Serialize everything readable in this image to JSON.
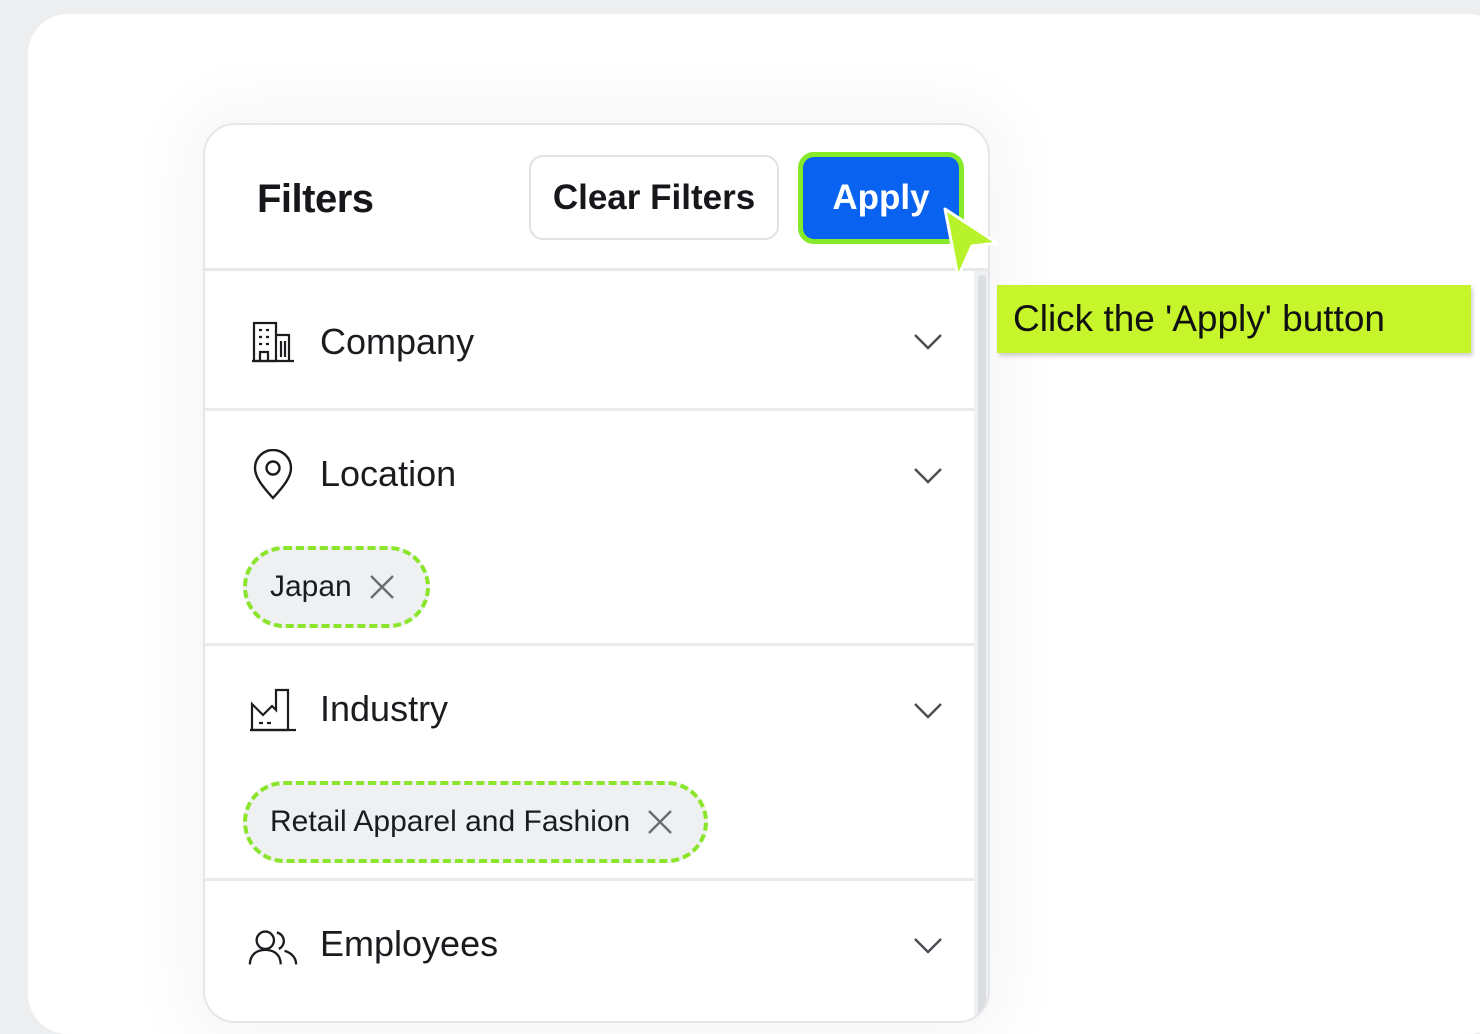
{
  "filters": {
    "title": "Filters",
    "clear_label": "Clear Filters",
    "apply_label": "Apply"
  },
  "sections": [
    {
      "label": "Company",
      "icon": "building-icon"
    },
    {
      "label": "Location",
      "icon": "map-pin-icon",
      "chips": [
        "Japan"
      ]
    },
    {
      "label": "Industry",
      "icon": "factory-icon",
      "chips": [
        "Retail Apparel and Fashion"
      ]
    },
    {
      "label": "Employees",
      "icon": "users-icon"
    }
  ],
  "tooltip": {
    "text": "Click the 'Apply' button"
  },
  "colors": {
    "apply_bg": "#0a62f0",
    "highlight": "#86ea2a",
    "tooltip_bg": "#c6f52b"
  }
}
